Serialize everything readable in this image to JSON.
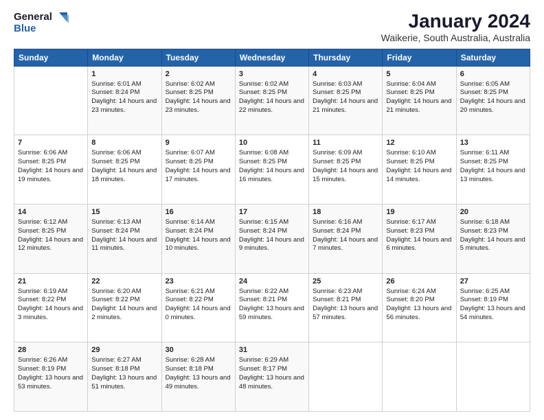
{
  "logo": {
    "line1": "General",
    "line2": "Blue"
  },
  "title": "January 2024",
  "subtitle": "Waikerie, South Australia, Australia",
  "days_of_week": [
    "Sunday",
    "Monday",
    "Tuesday",
    "Wednesday",
    "Thursday",
    "Friday",
    "Saturday"
  ],
  "weeks": [
    [
      {
        "day": "",
        "sunrise": "",
        "sunset": "",
        "daylight": ""
      },
      {
        "day": "1",
        "sunrise": "Sunrise: 6:01 AM",
        "sunset": "Sunset: 8:24 PM",
        "daylight": "Daylight: 14 hours and 23 minutes."
      },
      {
        "day": "2",
        "sunrise": "Sunrise: 6:02 AM",
        "sunset": "Sunset: 8:25 PM",
        "daylight": "Daylight: 14 hours and 23 minutes."
      },
      {
        "day": "3",
        "sunrise": "Sunrise: 6:02 AM",
        "sunset": "Sunset: 8:25 PM",
        "daylight": "Daylight: 14 hours and 22 minutes."
      },
      {
        "day": "4",
        "sunrise": "Sunrise: 6:03 AM",
        "sunset": "Sunset: 8:25 PM",
        "daylight": "Daylight: 14 hours and 21 minutes."
      },
      {
        "day": "5",
        "sunrise": "Sunrise: 6:04 AM",
        "sunset": "Sunset: 8:25 PM",
        "daylight": "Daylight: 14 hours and 21 minutes."
      },
      {
        "day": "6",
        "sunrise": "Sunrise: 6:05 AM",
        "sunset": "Sunset: 8:25 PM",
        "daylight": "Daylight: 14 hours and 20 minutes."
      }
    ],
    [
      {
        "day": "7",
        "sunrise": "Sunrise: 6:06 AM",
        "sunset": "Sunset: 8:25 PM",
        "daylight": "Daylight: 14 hours and 19 minutes."
      },
      {
        "day": "8",
        "sunrise": "Sunrise: 6:06 AM",
        "sunset": "Sunset: 8:25 PM",
        "daylight": "Daylight: 14 hours and 18 minutes."
      },
      {
        "day": "9",
        "sunrise": "Sunrise: 6:07 AM",
        "sunset": "Sunset: 8:25 PM",
        "daylight": "Daylight: 14 hours and 17 minutes."
      },
      {
        "day": "10",
        "sunrise": "Sunrise: 6:08 AM",
        "sunset": "Sunset: 8:25 PM",
        "daylight": "Daylight: 14 hours and 16 minutes."
      },
      {
        "day": "11",
        "sunrise": "Sunrise: 6:09 AM",
        "sunset": "Sunset: 8:25 PM",
        "daylight": "Daylight: 14 hours and 15 minutes."
      },
      {
        "day": "12",
        "sunrise": "Sunrise: 6:10 AM",
        "sunset": "Sunset: 8:25 PM",
        "daylight": "Daylight: 14 hours and 14 minutes."
      },
      {
        "day": "13",
        "sunrise": "Sunrise: 6:11 AM",
        "sunset": "Sunset: 8:25 PM",
        "daylight": "Daylight: 14 hours and 13 minutes."
      }
    ],
    [
      {
        "day": "14",
        "sunrise": "Sunrise: 6:12 AM",
        "sunset": "Sunset: 8:25 PM",
        "daylight": "Daylight: 14 hours and 12 minutes."
      },
      {
        "day": "15",
        "sunrise": "Sunrise: 6:13 AM",
        "sunset": "Sunset: 8:24 PM",
        "daylight": "Daylight: 14 hours and 11 minutes."
      },
      {
        "day": "16",
        "sunrise": "Sunrise: 6:14 AM",
        "sunset": "Sunset: 8:24 PM",
        "daylight": "Daylight: 14 hours and 10 minutes."
      },
      {
        "day": "17",
        "sunrise": "Sunrise: 6:15 AM",
        "sunset": "Sunset: 8:24 PM",
        "daylight": "Daylight: 14 hours and 9 minutes."
      },
      {
        "day": "18",
        "sunrise": "Sunrise: 6:16 AM",
        "sunset": "Sunset: 8:24 PM",
        "daylight": "Daylight: 14 hours and 7 minutes."
      },
      {
        "day": "19",
        "sunrise": "Sunrise: 6:17 AM",
        "sunset": "Sunset: 8:23 PM",
        "daylight": "Daylight: 14 hours and 6 minutes."
      },
      {
        "day": "20",
        "sunrise": "Sunrise: 6:18 AM",
        "sunset": "Sunset: 8:23 PM",
        "daylight": "Daylight: 14 hours and 5 minutes."
      }
    ],
    [
      {
        "day": "21",
        "sunrise": "Sunrise: 6:19 AM",
        "sunset": "Sunset: 8:22 PM",
        "daylight": "Daylight: 14 hours and 3 minutes."
      },
      {
        "day": "22",
        "sunrise": "Sunrise: 6:20 AM",
        "sunset": "Sunset: 8:22 PM",
        "daylight": "Daylight: 14 hours and 2 minutes."
      },
      {
        "day": "23",
        "sunrise": "Sunrise: 6:21 AM",
        "sunset": "Sunset: 8:22 PM",
        "daylight": "Daylight: 14 hours and 0 minutes."
      },
      {
        "day": "24",
        "sunrise": "Sunrise: 6:22 AM",
        "sunset": "Sunset: 8:21 PM",
        "daylight": "Daylight: 13 hours and 59 minutes."
      },
      {
        "day": "25",
        "sunrise": "Sunrise: 6:23 AM",
        "sunset": "Sunset: 8:21 PM",
        "daylight": "Daylight: 13 hours and 57 minutes."
      },
      {
        "day": "26",
        "sunrise": "Sunrise: 6:24 AM",
        "sunset": "Sunset: 8:20 PM",
        "daylight": "Daylight: 13 hours and 56 minutes."
      },
      {
        "day": "27",
        "sunrise": "Sunrise: 6:25 AM",
        "sunset": "Sunset: 8:19 PM",
        "daylight": "Daylight: 13 hours and 54 minutes."
      }
    ],
    [
      {
        "day": "28",
        "sunrise": "Sunrise: 6:26 AM",
        "sunset": "Sunset: 8:19 PM",
        "daylight": "Daylight: 13 hours and 53 minutes."
      },
      {
        "day": "29",
        "sunrise": "Sunrise: 6:27 AM",
        "sunset": "Sunset: 8:18 PM",
        "daylight": "Daylight: 13 hours and 51 minutes."
      },
      {
        "day": "30",
        "sunrise": "Sunrise: 6:28 AM",
        "sunset": "Sunset: 8:18 PM",
        "daylight": "Daylight: 13 hours and 49 minutes."
      },
      {
        "day": "31",
        "sunrise": "Sunrise: 6:29 AM",
        "sunset": "Sunset: 8:17 PM",
        "daylight": "Daylight: 13 hours and 48 minutes."
      },
      {
        "day": "",
        "sunrise": "",
        "sunset": "",
        "daylight": ""
      },
      {
        "day": "",
        "sunrise": "",
        "sunset": "",
        "daylight": ""
      },
      {
        "day": "",
        "sunrise": "",
        "sunset": "",
        "daylight": ""
      }
    ]
  ],
  "colors": {
    "header_bg": "#2563a8",
    "header_text": "#ffffff",
    "title_color": "#1a1a2e",
    "logo_blue": "#2563a8"
  }
}
